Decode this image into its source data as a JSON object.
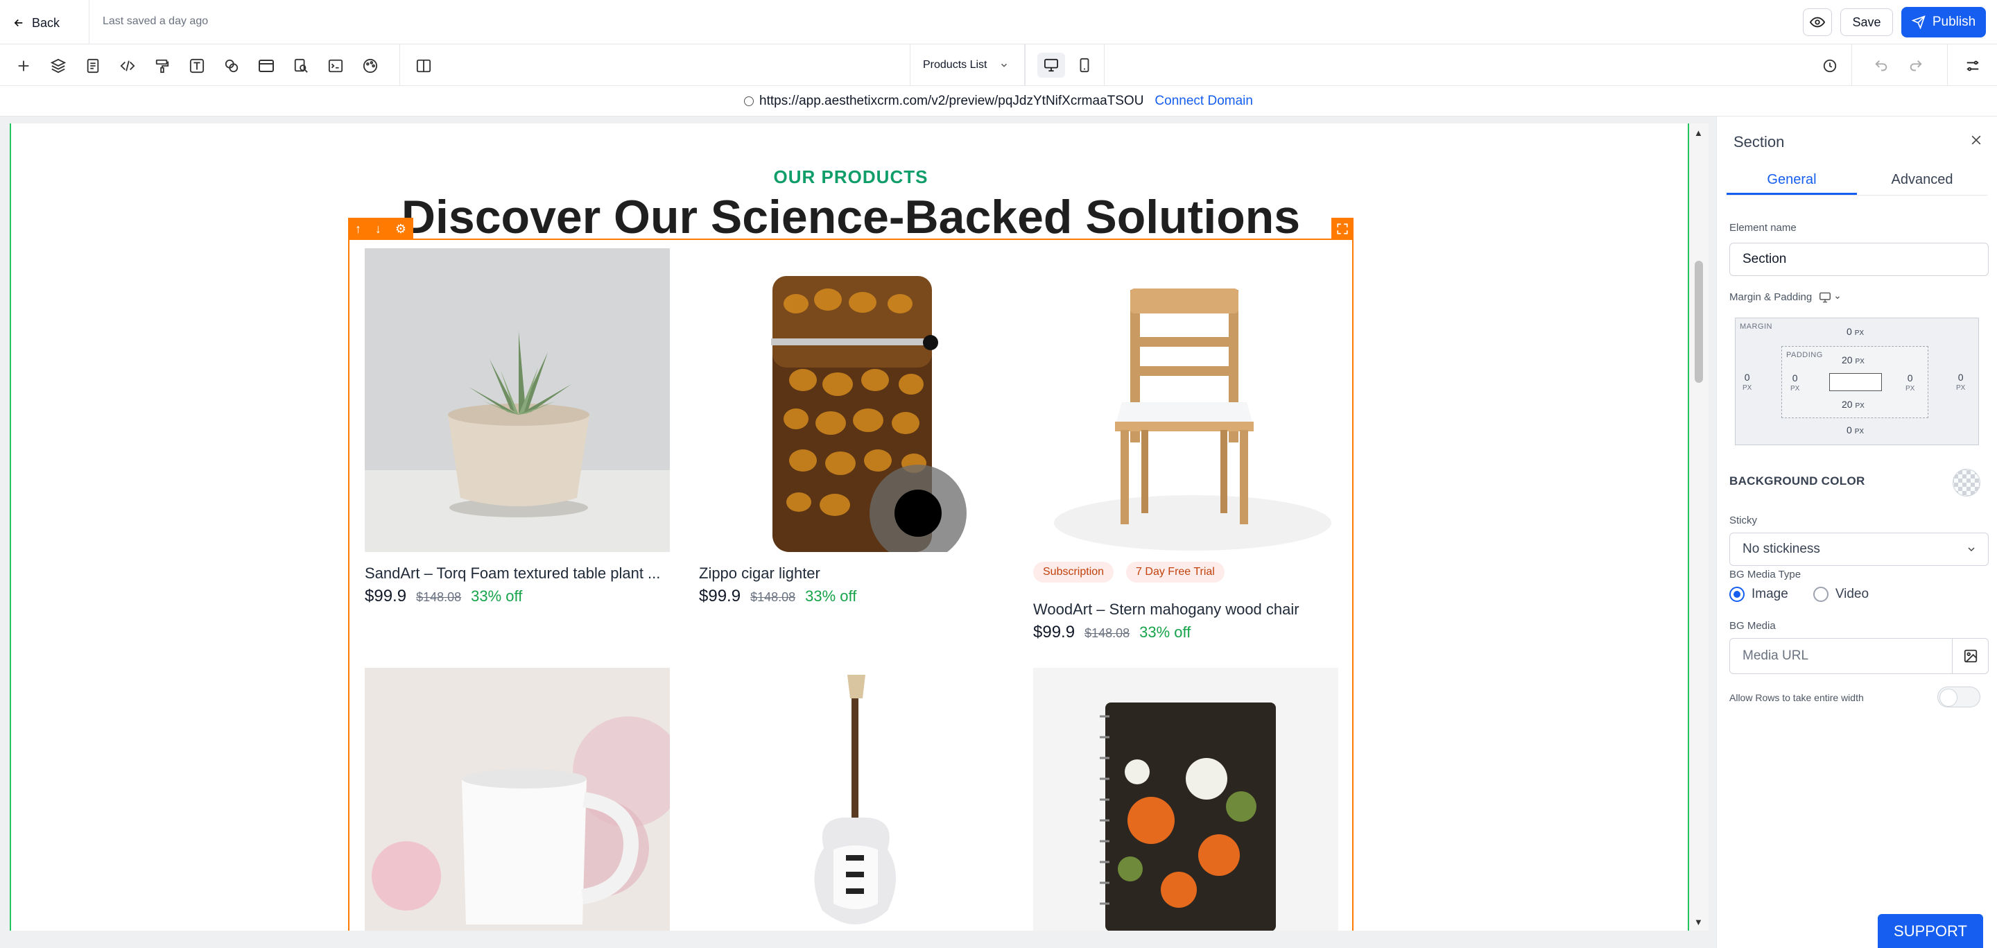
{
  "topbar": {
    "back_label": "Back",
    "last_saved": "Last saved a day ago",
    "save_label": "Save",
    "publish_label": "Publish"
  },
  "toolbar": {
    "page_select": "Products List",
    "tools": [
      "add-icon",
      "layers-icon",
      "page-icon",
      "code-icon",
      "paint-roller-icon",
      "text-icon",
      "shapes-icon",
      "layout-icon",
      "search-doc-icon",
      "terminal-icon",
      "palette-icon",
      "split-view-icon"
    ]
  },
  "urlbar": {
    "url": "https://app.aesthetixcrm.com/v2/preview/pqJdzYtNifXcrmaaTSOU",
    "connect_label": "Connect Domain"
  },
  "canvas": {
    "eyebrow": "OUR PRODUCTS",
    "headline": "Discover Our Science-Backed Solutions",
    "products": [
      {
        "title": "SandArt – Torq Foam textured table plant ...",
        "price": "$99.9",
        "old_price": "$148.08",
        "discount": "33% off",
        "image": "succulent-pot"
      },
      {
        "title": "Zippo cigar lighter",
        "price": "$99.9",
        "old_price": "$148.08",
        "discount": "33% off",
        "image": "lighter"
      },
      {
        "title": "WoodArt – Stern mahogany wood chair",
        "price": "$99.9",
        "old_price": "$148.08",
        "discount": "33% off",
        "image": "chair",
        "badges": [
          "Subscription",
          "7 Day Free Trial"
        ]
      },
      {
        "image": "mug"
      },
      {
        "image": "guitar"
      },
      {
        "image": "notebook"
      }
    ]
  },
  "panel": {
    "title": "Section",
    "tabs": [
      "General",
      "Advanced"
    ],
    "element_name_label": "Element name",
    "element_name_value": "Section",
    "margin_padding_label": "Margin & Padding",
    "margin_label": "MARGIN",
    "padding_label": "PADDING",
    "margin": {
      "top": "0",
      "bottom": "0",
      "left": "0",
      "right": "0"
    },
    "padding": {
      "top": "20",
      "bottom": "20",
      "left": "0",
      "right": "0"
    },
    "unit": "PX",
    "background_color_label": "BACKGROUND COLOR",
    "sticky_label": "Sticky",
    "sticky_value": "No stickiness",
    "bg_media_type_label": "BG Media Type",
    "media_type_options": [
      "Image",
      "Video"
    ],
    "media_type_selected": "Image",
    "bg_media_label": "BG Media",
    "media_url_placeholder": "Media URL",
    "allow_rows_label": "Allow Rows to take entire width",
    "allow_rows_enabled": false
  },
  "support_label": "SUPPORT",
  "colors": {
    "accent": "#155eef",
    "selection": "#ff7a00",
    "eyebrow": "#0f9d6a",
    "discount": "#16a34a"
  }
}
